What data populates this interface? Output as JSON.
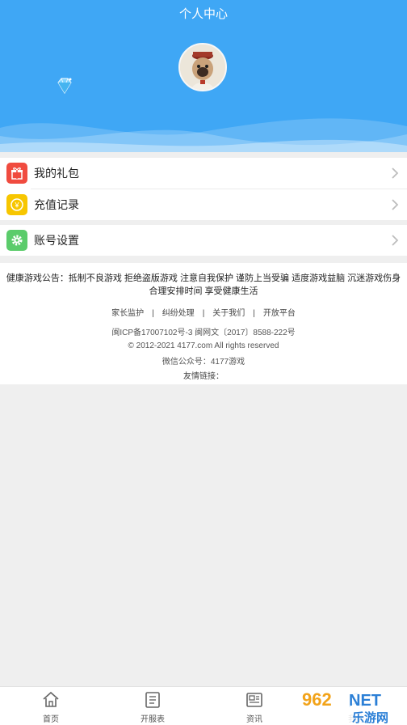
{
  "header": {
    "title": "个人中心"
  },
  "menu_group1": [
    {
      "label": "我的礼包",
      "icon": "gift-icon",
      "color": "#f04b3f"
    },
    {
      "label": "充值记录",
      "icon": "yen-icon",
      "color": "#f7c600"
    }
  ],
  "menu_group2": [
    {
      "label": "账号设置",
      "icon": "gear-icon",
      "color": "#5bcc6b"
    }
  ],
  "footer": {
    "notice": "健康游戏公告：抵制不良游戏 拒绝盗版游戏 注意自我保护 谨防上当受骗 适度游戏益脑 沉迷游戏伤身 合理安排时间 享受健康生活",
    "links": [
      "家长监护",
      "纠纷处理",
      "关于我们",
      "开放平台"
    ],
    "link_separator": "|",
    "icp": "闽ICP备17007102号-3   闽网文〔2017〕8588-222号",
    "copyright": "© 2012-2021 4177.com All rights reserved",
    "wechat": "微信公众号：4177游戏",
    "friend_links": "友情链接："
  },
  "tabbar": [
    {
      "label": "首页",
      "icon": "home-icon"
    },
    {
      "label": "开服表",
      "icon": "list-icon"
    },
    {
      "label": "资讯",
      "icon": "news-icon"
    },
    {
      "label": "我的",
      "icon": "user-icon"
    }
  ],
  "watermark": {
    "top": "962",
    "top2": "NET",
    "bottom": "乐游网"
  },
  "colors": {
    "header_bg": "#3fa7f5",
    "page_bg": "#efefef"
  }
}
